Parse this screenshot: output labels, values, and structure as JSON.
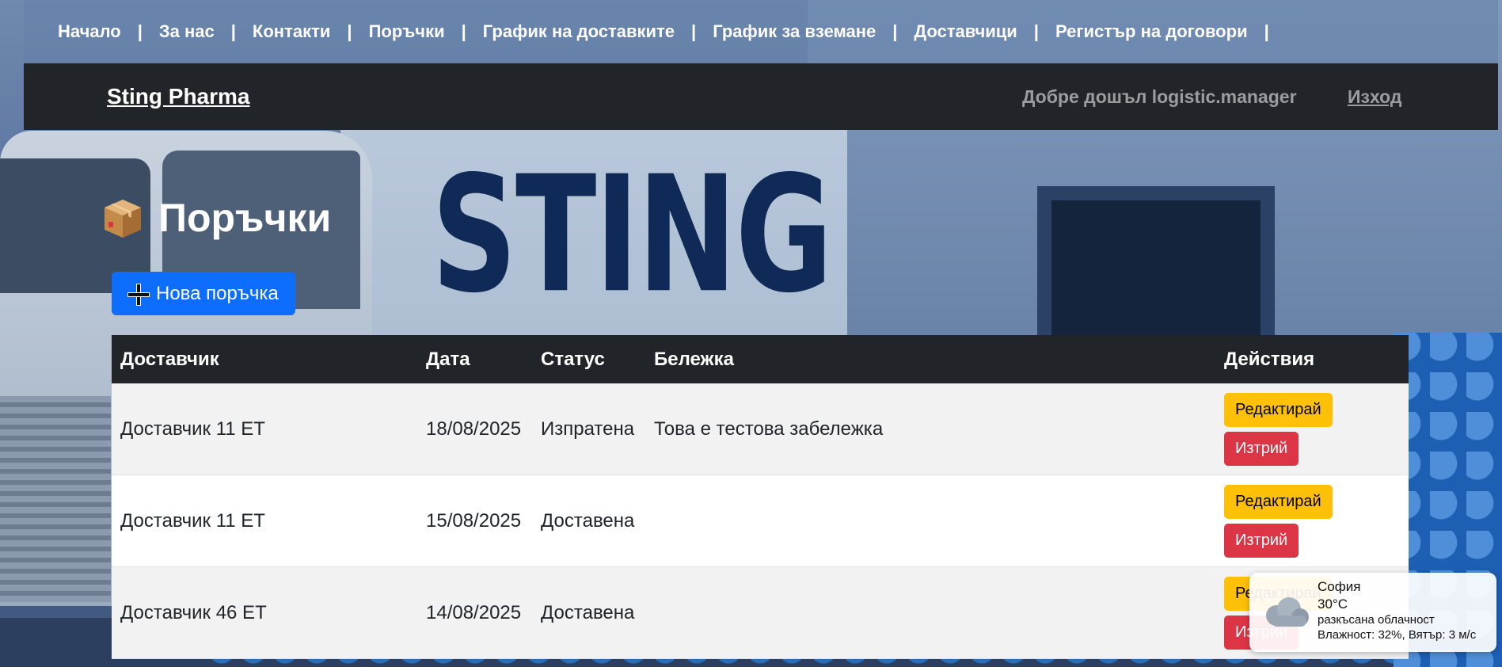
{
  "nav": {
    "items": [
      "Начало",
      "За нас",
      "Контакти",
      "Поръчки",
      "График на доставките",
      "График за вземане",
      "Доставчици",
      "Регистър на договори"
    ],
    "separator": "|"
  },
  "header": {
    "brand": "Sting Pharma",
    "welcome": "Добре дошъл logistic.manager",
    "logout": "Изход"
  },
  "page": {
    "title": "Поръчки",
    "title_icon": "package-box-icon",
    "new_order_label": "Нова поръчка",
    "background_text": "STING"
  },
  "table": {
    "headers": [
      "Доставчик",
      "Дата",
      "Статус",
      "Бележка",
      "Действия"
    ],
    "rows": [
      {
        "supplier": "Доставчик 11 ЕТ",
        "date": "18/08/2025",
        "status": "Изпратена",
        "note": "Това е тестова забележка"
      },
      {
        "supplier": "Доставчик 11 ЕТ",
        "date": "15/08/2025",
        "status": "Доставена",
        "note": ""
      },
      {
        "supplier": "Доставчик 46 ЕТ",
        "date": "14/08/2025",
        "status": "Доставена",
        "note": ""
      }
    ],
    "edit_label": "Редактирай",
    "delete_label": "Изтрий"
  },
  "weather": {
    "city": "София",
    "temp": "30°C",
    "description": "разкъсана облачност",
    "details": "Влажност: 32%, Вятър: 3 м/с",
    "icon": "cloud-icon"
  },
  "colors": {
    "primary": "#0d6efd",
    "warning": "#ffc107",
    "danger": "#dc3545",
    "dark": "#212529"
  }
}
